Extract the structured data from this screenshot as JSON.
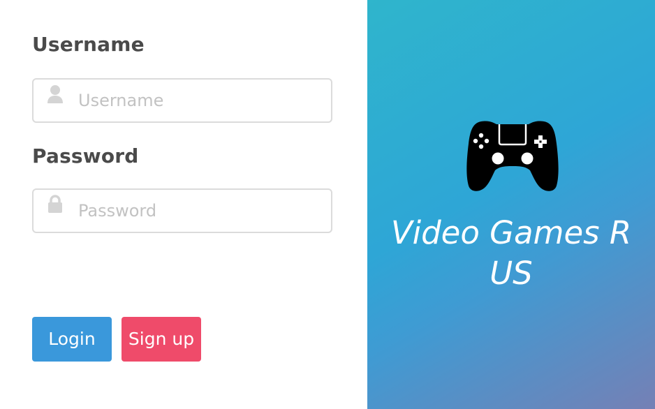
{
  "form": {
    "username_label": "Username",
    "username_placeholder": "Username",
    "username_value": "",
    "username_icon": "user-icon",
    "password_label": "Password",
    "password_placeholder": "Password",
    "password_value": "",
    "password_icon": "lock-icon"
  },
  "buttons": {
    "login_label": "Login",
    "signup_label": "Sign up"
  },
  "brand": {
    "icon": "gamepad-icon",
    "title": "Video Games R US"
  },
  "colors": {
    "login_button": "#3a98db",
    "signup_button": "#ef4b6a",
    "panel_gradient_start": "#2fb5cc",
    "panel_gradient_end": "#7580b5"
  }
}
